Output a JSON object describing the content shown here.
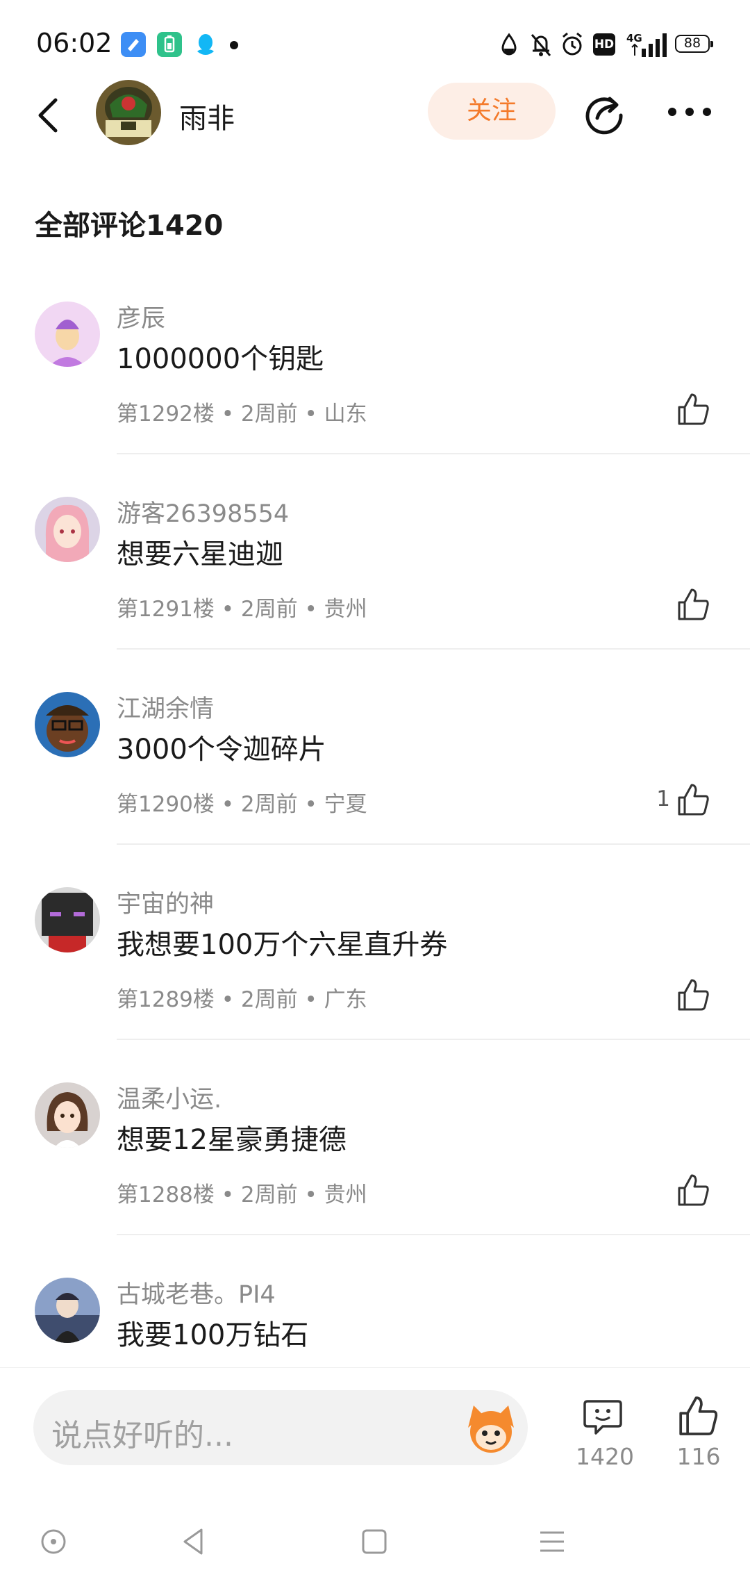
{
  "status_bar": {
    "time": "06:02",
    "network": "4G",
    "battery": "88",
    "hd_label": "HD"
  },
  "header": {
    "user_name": "雨非",
    "follow_label": "关注"
  },
  "section": {
    "title": "全部评论1420"
  },
  "comments": [
    {
      "name": "彦辰",
      "text": "1000000个钥匙",
      "meta": "第1292楼 • 2周前 • 山东",
      "likes": ""
    },
    {
      "name": "游客26398554",
      "text": "想要六星迪迦",
      "meta": "第1291楼 • 2周前 • 贵州",
      "likes": ""
    },
    {
      "name": "江湖余情",
      "text": "3000个令迦碎片",
      "meta": "第1290楼 • 2周前 • 宁夏",
      "likes": "1"
    },
    {
      "name": "宇宙的神",
      "text": "我想要100万个六星直升券",
      "meta": "第1289楼 • 2周前 • 广东",
      "likes": ""
    },
    {
      "name": "温柔小运.",
      "text": "想要12星豪勇捷德",
      "meta": "第1288楼 • 2周前 • 贵州",
      "likes": ""
    },
    {
      "name": "古城老巷。PI4",
      "text": "我要100万钻石",
      "meta": "",
      "likes": ""
    }
  ],
  "input_bar": {
    "placeholder": "说点好听的...",
    "comment_count": "1420",
    "like_count": "116"
  },
  "colors": {
    "accent": "#f47a2b",
    "follow_bg": "#fdeee6",
    "muted_text": "#8a8a8a",
    "divider": "#eeeeee"
  }
}
